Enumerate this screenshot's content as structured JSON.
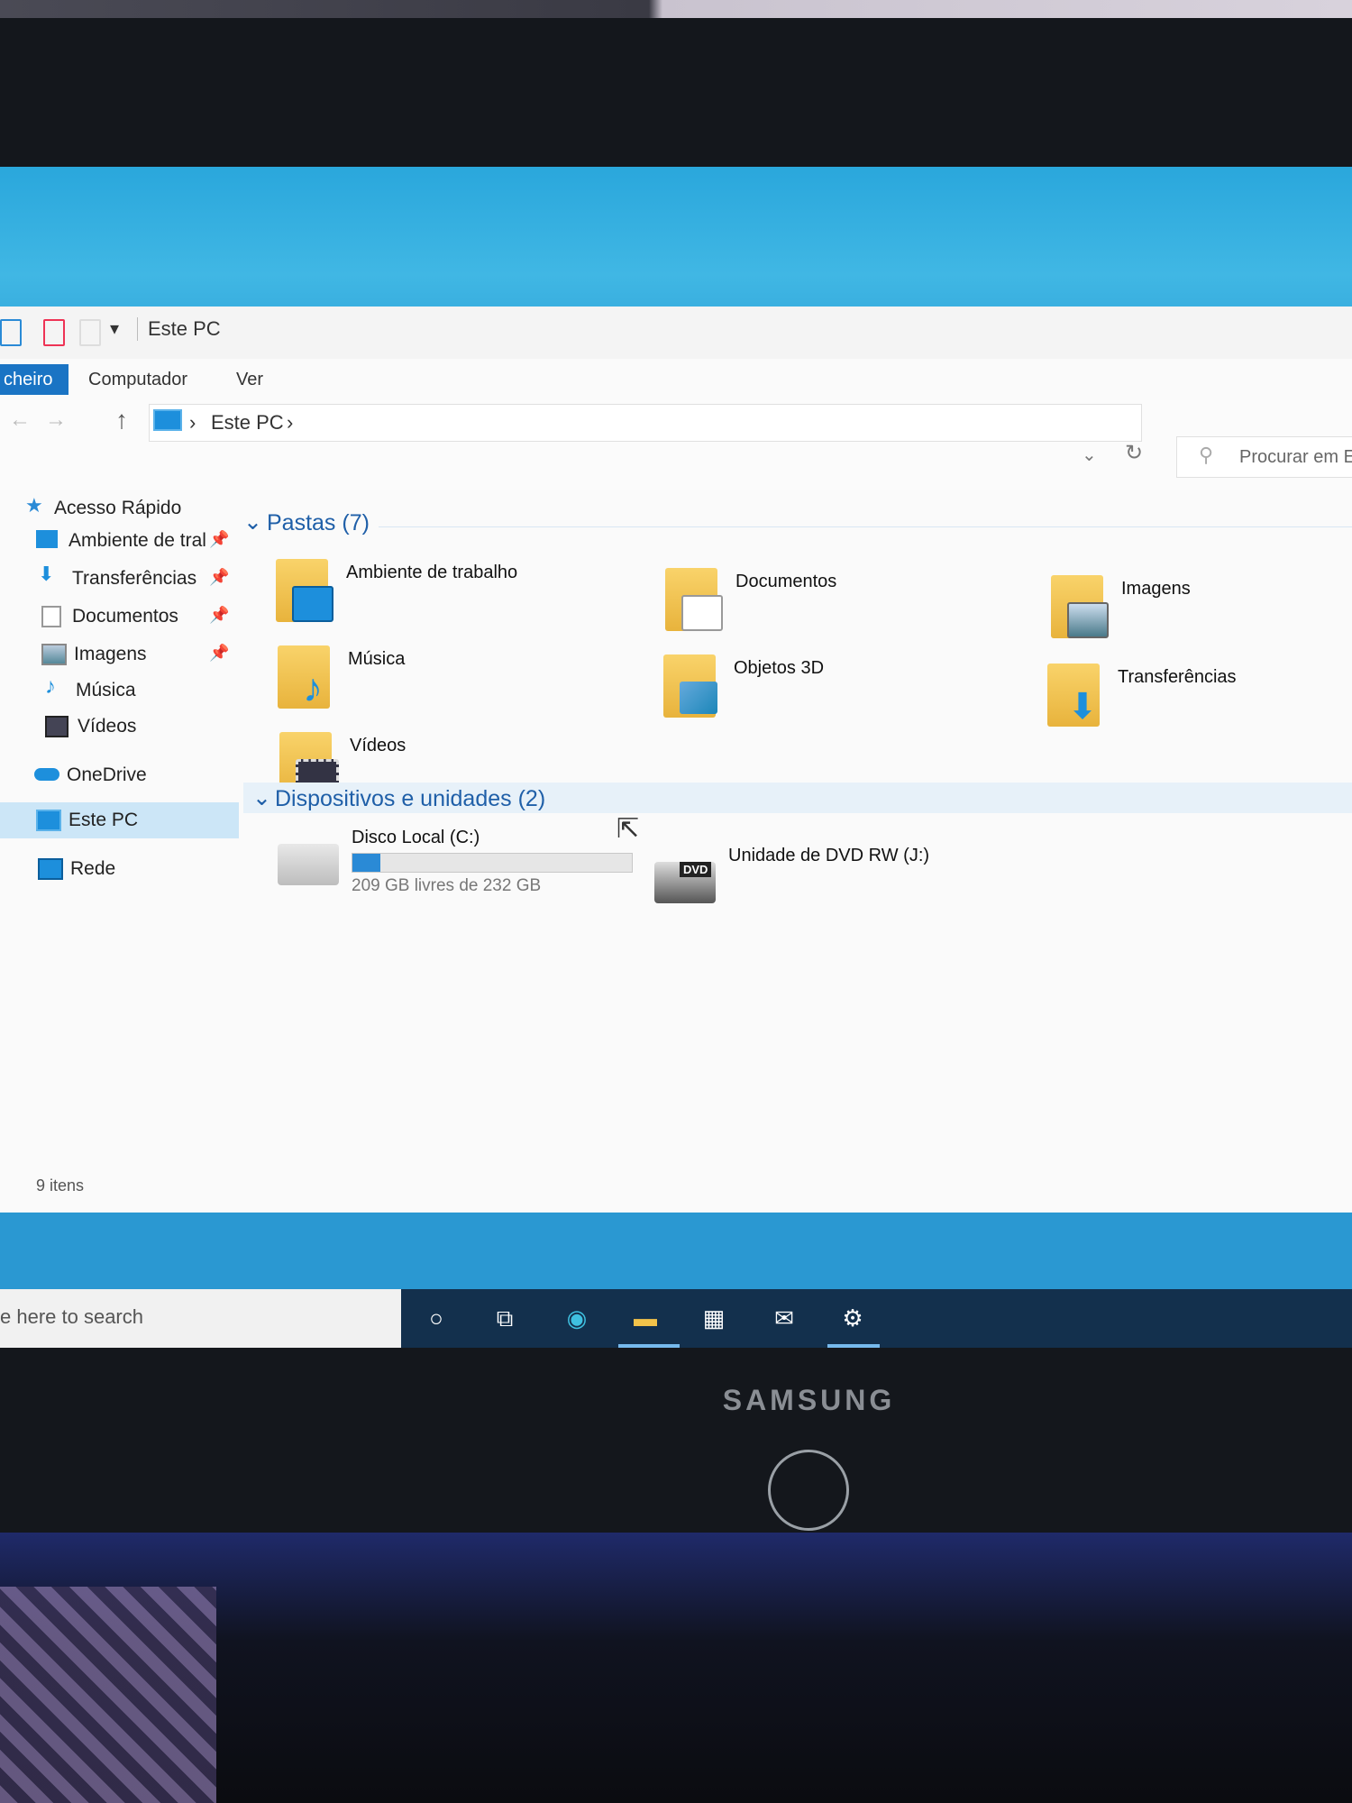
{
  "window": {
    "title": "Este PC",
    "tabs": [
      "cheiro",
      "Computador",
      "Ver"
    ]
  },
  "address": {
    "crumb": "Este PC",
    "search_placeholder": "Procurar em E"
  },
  "sidebar": {
    "items": [
      {
        "label": "Acesso Rápido",
        "icon": "star-icon",
        "pinned": false
      },
      {
        "label": "Ambiente de tral",
        "icon": "desktop-icon",
        "pinned": true
      },
      {
        "label": "Transferências",
        "icon": "download-icon",
        "pinned": true
      },
      {
        "label": "Documentos",
        "icon": "document-icon",
        "pinned": true
      },
      {
        "label": "Imagens",
        "icon": "image-icon",
        "pinned": true
      },
      {
        "label": "Música",
        "icon": "music-icon",
        "pinned": false
      },
      {
        "label": "Vídeos",
        "icon": "video-icon",
        "pinned": false
      },
      {
        "label": "OneDrive",
        "icon": "cloud-icon",
        "pinned": false
      },
      {
        "label": "Este PC",
        "icon": "computer-icon",
        "pinned": false,
        "selected": true
      },
      {
        "label": "Rede",
        "icon": "network-icon",
        "pinned": false
      }
    ]
  },
  "content": {
    "folders_header": "Pastas (7)",
    "folders": [
      {
        "label": "Ambiente de trabalho",
        "icon": "desktop-folder-icon"
      },
      {
        "label": "Documentos",
        "icon": "documents-folder-icon"
      },
      {
        "label": "Imagens",
        "icon": "pictures-folder-icon"
      },
      {
        "label": "Música",
        "icon": "music-folder-icon"
      },
      {
        "label": "Objetos 3D",
        "icon": "3d-objects-folder-icon"
      },
      {
        "label": "Transferências",
        "icon": "downloads-folder-icon"
      },
      {
        "label": "Vídeos",
        "icon": "videos-folder-icon"
      }
    ],
    "devices_header": "Dispositivos e unidades (2)",
    "drives": [
      {
        "label": "Disco Local (C:)",
        "free": "209 GB livres de 232 GB",
        "used_fraction": 0.099
      },
      {
        "label": "Unidade de DVD RW (J:)",
        "tag": "DVD"
      }
    ]
  },
  "status": {
    "count": "9 itens"
  },
  "taskbar": {
    "search_text": "e here to search",
    "icons": [
      "cortana-circle-icon",
      "task-view-icon",
      "edge-icon",
      "file-explorer-icon",
      "store-icon",
      "mail-icon",
      "settings-icon"
    ]
  },
  "monitor": {
    "brand": "SAMSUNG"
  }
}
